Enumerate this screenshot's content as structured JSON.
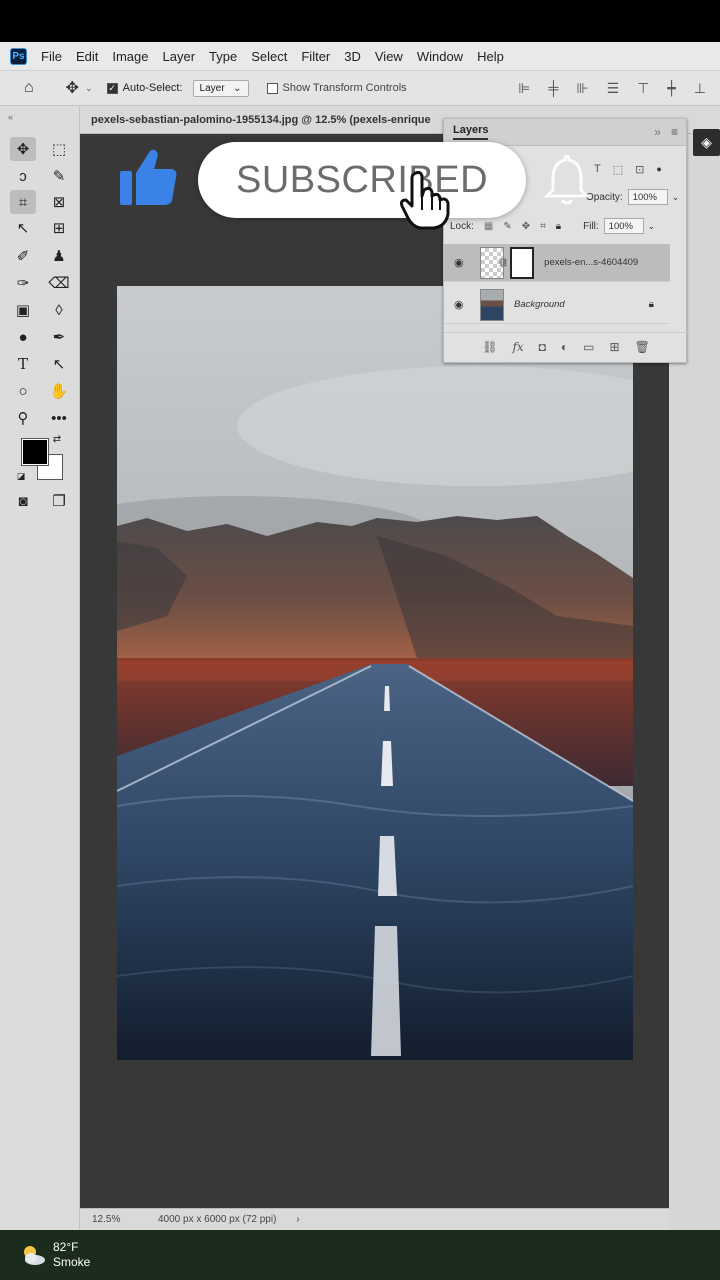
{
  "menubar": {
    "app_logo": "Ps",
    "items": [
      "File",
      "Edit",
      "Image",
      "Layer",
      "Type",
      "Select",
      "Filter",
      "3D",
      "View",
      "Window",
      "Help"
    ]
  },
  "options_bar": {
    "auto_select_label": "Auto-Select:",
    "auto_select_checked": true,
    "auto_select_target": "Layer",
    "transform_controls_label": "Show Transform Controls",
    "transform_controls_checked": false
  },
  "document": {
    "tab_title": "pexels-sebastian-palomino-1955134.jpg @ 12.5% (pexels-enrique"
  },
  "layers_panel": {
    "title": "Layers",
    "opacity_label": "Opacity:",
    "opacity_value": "100%",
    "lock_label": "Lock:",
    "fill_label": "Fill:",
    "fill_value": "100%",
    "layers": [
      {
        "name": "pexels-en...s-4604409",
        "visible": true,
        "selected": true,
        "has_mask": true
      },
      {
        "name": "Background",
        "visible": true,
        "selected": false,
        "locked": true
      }
    ]
  },
  "status_bar": {
    "zoom": "12.5%",
    "dimensions": "4000 px x 6000 px (72 ppi)",
    "arrow": "›"
  },
  "overlay": {
    "subscribe_text": "SUBSCRIBED"
  },
  "taskbar": {
    "temperature": "82°F",
    "condition": "Smoke"
  },
  "colors": {
    "accent_blue": "#3b82e6",
    "canvas_bg": "#383838",
    "taskbar_bg": "#1b2b1c"
  }
}
